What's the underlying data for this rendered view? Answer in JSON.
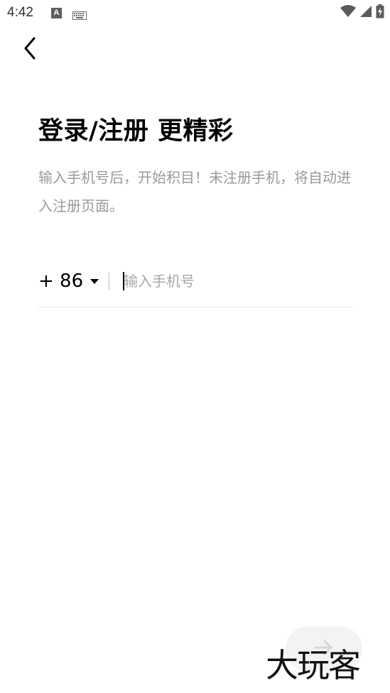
{
  "status_bar": {
    "time": "4:42",
    "a_icon_label": "A",
    "icons": [
      "a-notification-icon",
      "keyboard-icon",
      "wifi-icon",
      "signal-icon",
      "battery-charging-icon"
    ]
  },
  "header": {
    "back_icon": "chevron-left-icon"
  },
  "main": {
    "title": "登录/注册 更精彩",
    "subtitle": "输入手机号后，开始积目！未注册手机，将自动进入注册页面。",
    "phone": {
      "country_code": "+ 86",
      "placeholder": "输入手机号",
      "value": ""
    }
  },
  "footer": {
    "next_icon": "arrow-right-icon"
  },
  "watermark": {
    "text": "大玩客"
  },
  "colors": {
    "background": "#ffffff",
    "text_primary": "#000000",
    "text_secondary": "#9a9a9a",
    "divider": "#e6e6e6",
    "next_button_bg": "#f3f3f3"
  }
}
